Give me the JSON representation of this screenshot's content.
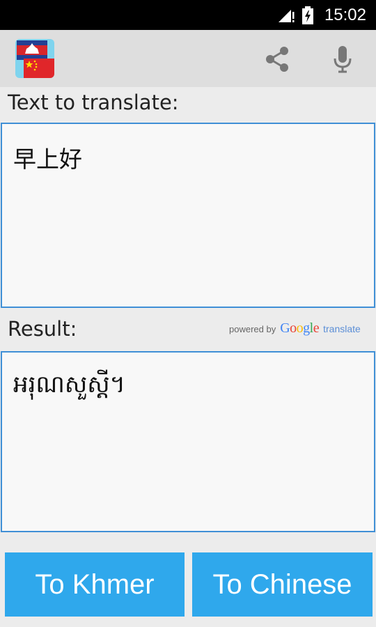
{
  "status_bar": {
    "time": "15:02",
    "icons": [
      "signal-icon",
      "battery-icon"
    ]
  },
  "action_bar": {
    "app_icon": "cambodia-china-flag-icon",
    "actions": [
      "share-icon",
      "microphone-icon"
    ]
  },
  "input_section": {
    "label": "Text to translate:",
    "text": "早上好"
  },
  "result_section": {
    "label": "Result:",
    "powered_by": "powered by",
    "google_letters": [
      "G",
      "o",
      "o",
      "g",
      "l",
      "e"
    ],
    "google_colors": [
      "#4285f4",
      "#ea4335",
      "#fbbc05",
      "#4285f4",
      "#34a853",
      "#ea4335"
    ],
    "translate_word": "translate",
    "text": "អរុណសួស្តី។"
  },
  "buttons": {
    "to_khmer": "To Khmer",
    "to_chinese": "To Chinese"
  },
  "colors": {
    "accent": "#2fa8ec",
    "box_border": "#3f8fd6",
    "action_bar": "#dedede",
    "background": "#ececec"
  }
}
